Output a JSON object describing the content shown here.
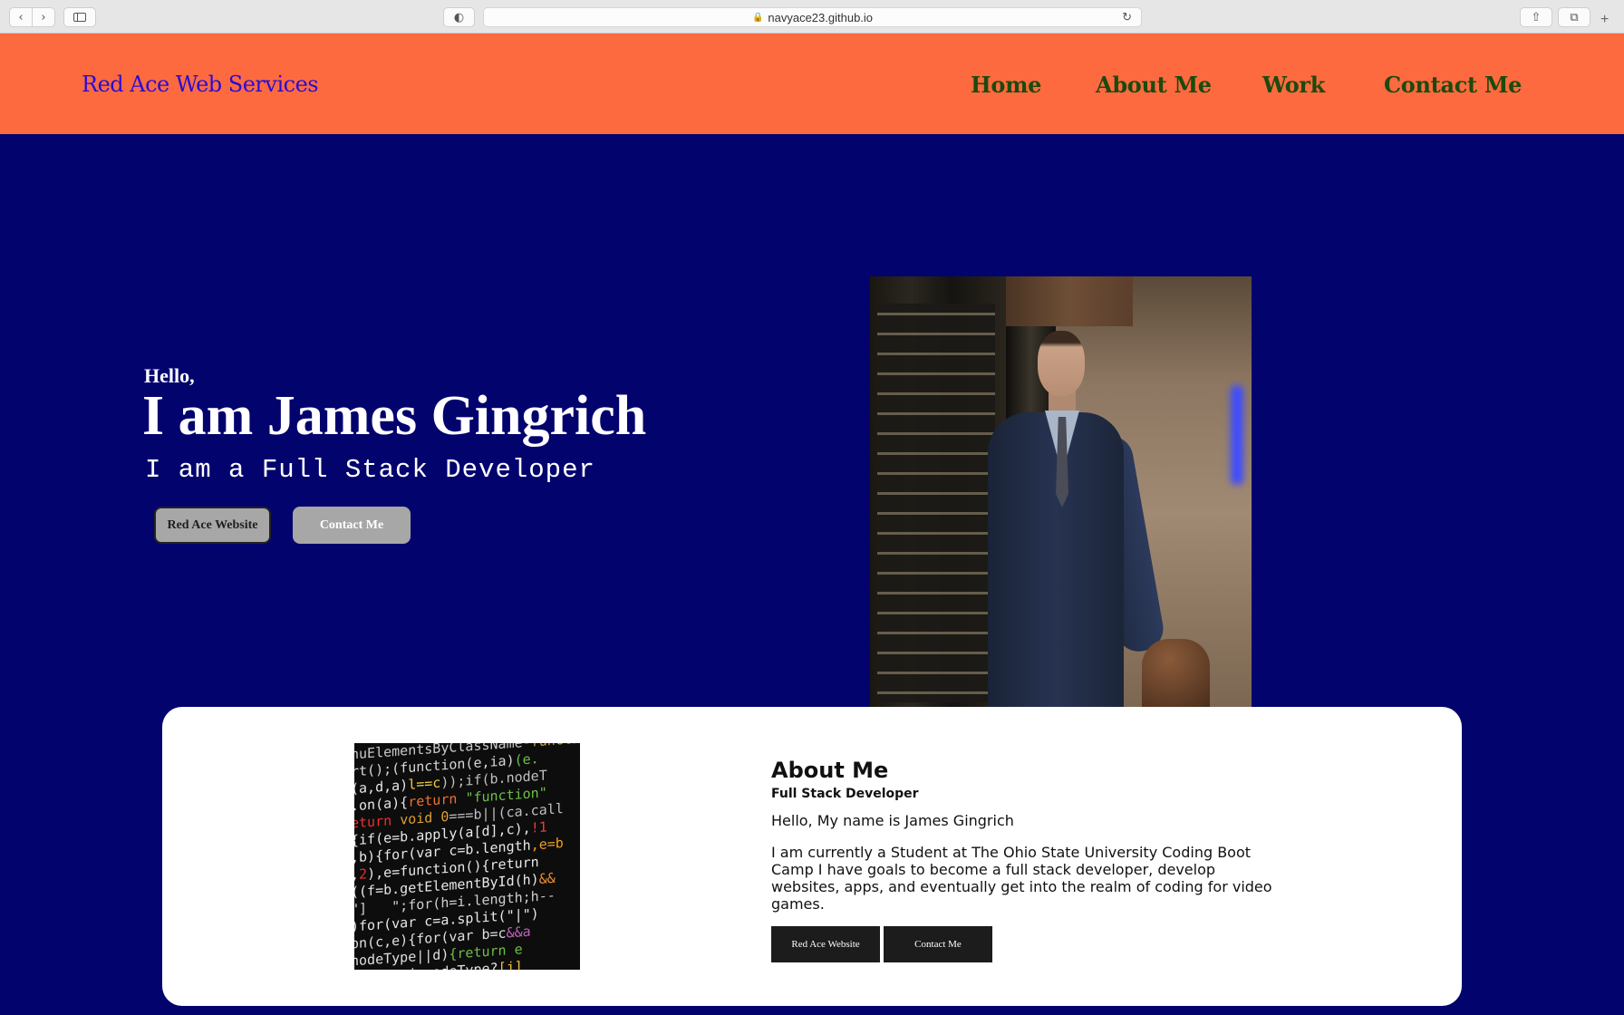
{
  "browser": {
    "url": "navyace23.github.io"
  },
  "header": {
    "brand": "Red Ace Web Services",
    "nav": [
      "Home",
      "About Me",
      "Work",
      "Contact Me"
    ]
  },
  "hero": {
    "greeting": "Hello,",
    "name": "I am James Gingrich",
    "role": "I am a Full Stack Developer",
    "buttons": [
      "Red Ace Website",
      "Contact Me"
    ]
  },
  "about": {
    "title": "About Me",
    "subtitle": "Full Stack Developer",
    "hello": "Hello, My name is James Gingrich",
    "body": "I am currently a Student at The Ohio State University Coding Boot Camp I have goals to become a full stack developer, develop websites, apps, and eventually get into the realm of coding for video games.",
    "buttons": [
      "Red Ace Website",
      "Contact Me"
    ]
  },
  "colors": {
    "header_bg": "#fd6a40",
    "page_bg": "#03036e",
    "brand_text": "#2a0cd4",
    "nav_text": "#1c4a0c"
  }
}
